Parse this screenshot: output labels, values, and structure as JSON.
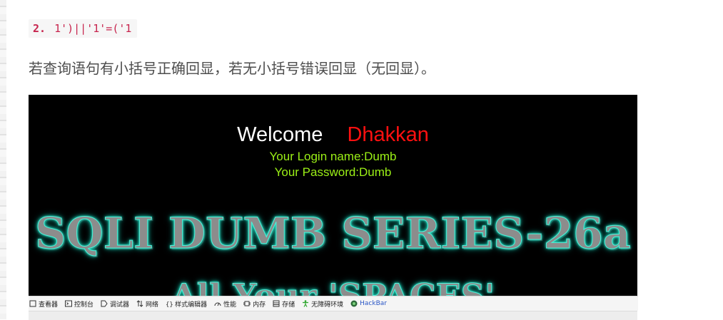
{
  "code_example": {
    "line_number": "2.",
    "code": "1')||'1'=('1"
  },
  "description": "若查询语句有小括号正确回显，若无小括号错误回显（无回显）。",
  "screenshot": {
    "welcome": "Welcome",
    "username": "Dhakkan",
    "login_name": "Your Login name:Dumb",
    "password": "Your Password:Dumb",
    "banner": "SQLI DUMB SERIES-26a",
    "banner_partial": "All Your 'SPACES'"
  },
  "devtools": {
    "tabs": [
      {
        "label": "查看器",
        "icon": "inspector-icon"
      },
      {
        "label": "控制台",
        "icon": "console-icon"
      },
      {
        "label": "调试器",
        "icon": "debugger-icon"
      },
      {
        "label": "网络",
        "icon": "network-icon"
      },
      {
        "label": "样式编辑器",
        "icon": "style-editor-icon"
      },
      {
        "label": "性能",
        "icon": "performance-icon"
      },
      {
        "label": "内存",
        "icon": "memory-icon"
      },
      {
        "label": "存储",
        "icon": "storage-icon"
      },
      {
        "label": "无障碍环境",
        "icon": "accessibility-icon"
      },
      {
        "label": "HackBar",
        "icon": "hackbar-icon"
      }
    ],
    "colors": {
      "hackbar_label": "#2a56c6",
      "accessibility_icon": "#2aa52a",
      "hackbar_icon": "#2e6b3a"
    }
  },
  "colors": {
    "code_text": "#c7254e",
    "welcome_text": "#ffffff",
    "username_text": "#ff1010",
    "credentials_text": "#9bf016",
    "banner_glow": "#20e0c0"
  }
}
